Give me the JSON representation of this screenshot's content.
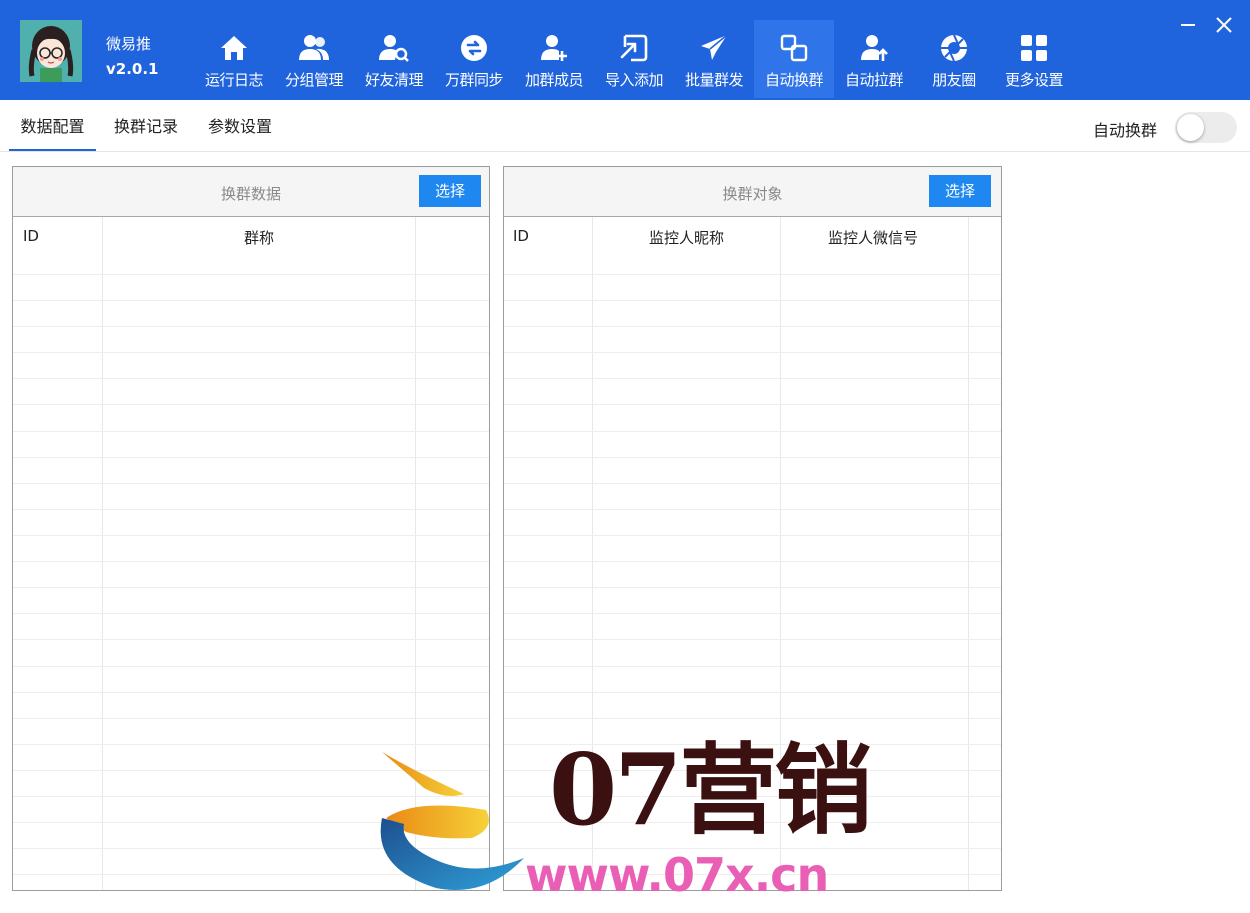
{
  "app": {
    "name": "微易推",
    "version": "v2.0.1"
  },
  "nav": [
    {
      "label": "运行日志",
      "icon": "home-icon"
    },
    {
      "label": "分组管理",
      "icon": "group-users-icon"
    },
    {
      "label": "好友清理",
      "icon": "user-search-icon"
    },
    {
      "label": "万群同步",
      "icon": "sync-icon"
    },
    {
      "label": "加群成员",
      "icon": "add-member-icon"
    },
    {
      "label": "导入添加",
      "icon": "import-icon"
    },
    {
      "label": "批量群发",
      "icon": "send-plane-icon"
    },
    {
      "label": "自动换群",
      "icon": "switch-group-icon",
      "active": true
    },
    {
      "label": "自动拉群",
      "icon": "pull-group-icon"
    },
    {
      "label": "朋友圈",
      "icon": "aperture-icon"
    },
    {
      "label": "更多设置",
      "icon": "apps-grid-icon"
    }
  ],
  "window": {
    "minimize_icon": "minimize-icon",
    "close_icon": "close-icon"
  },
  "tabs": [
    "数据配置",
    "换群记录",
    "参数设置"
  ],
  "toggle": {
    "label": "自动换群",
    "on": false
  },
  "left_panel": {
    "title": "换群数据",
    "button": "选择",
    "columns": [
      "ID",
      "群称"
    ]
  },
  "right_panel": {
    "title": "换群对象",
    "button": "选择",
    "columns": [
      "ID",
      "监控人昵称",
      "监控人微信号"
    ]
  },
  "watermark": {
    "title": "07营销",
    "url": "www.07x.cn"
  },
  "colors": {
    "header": "#1f63dd",
    "active_nav": "#2f74e8",
    "button": "#1e88f0",
    "url": "#e95fb6"
  }
}
